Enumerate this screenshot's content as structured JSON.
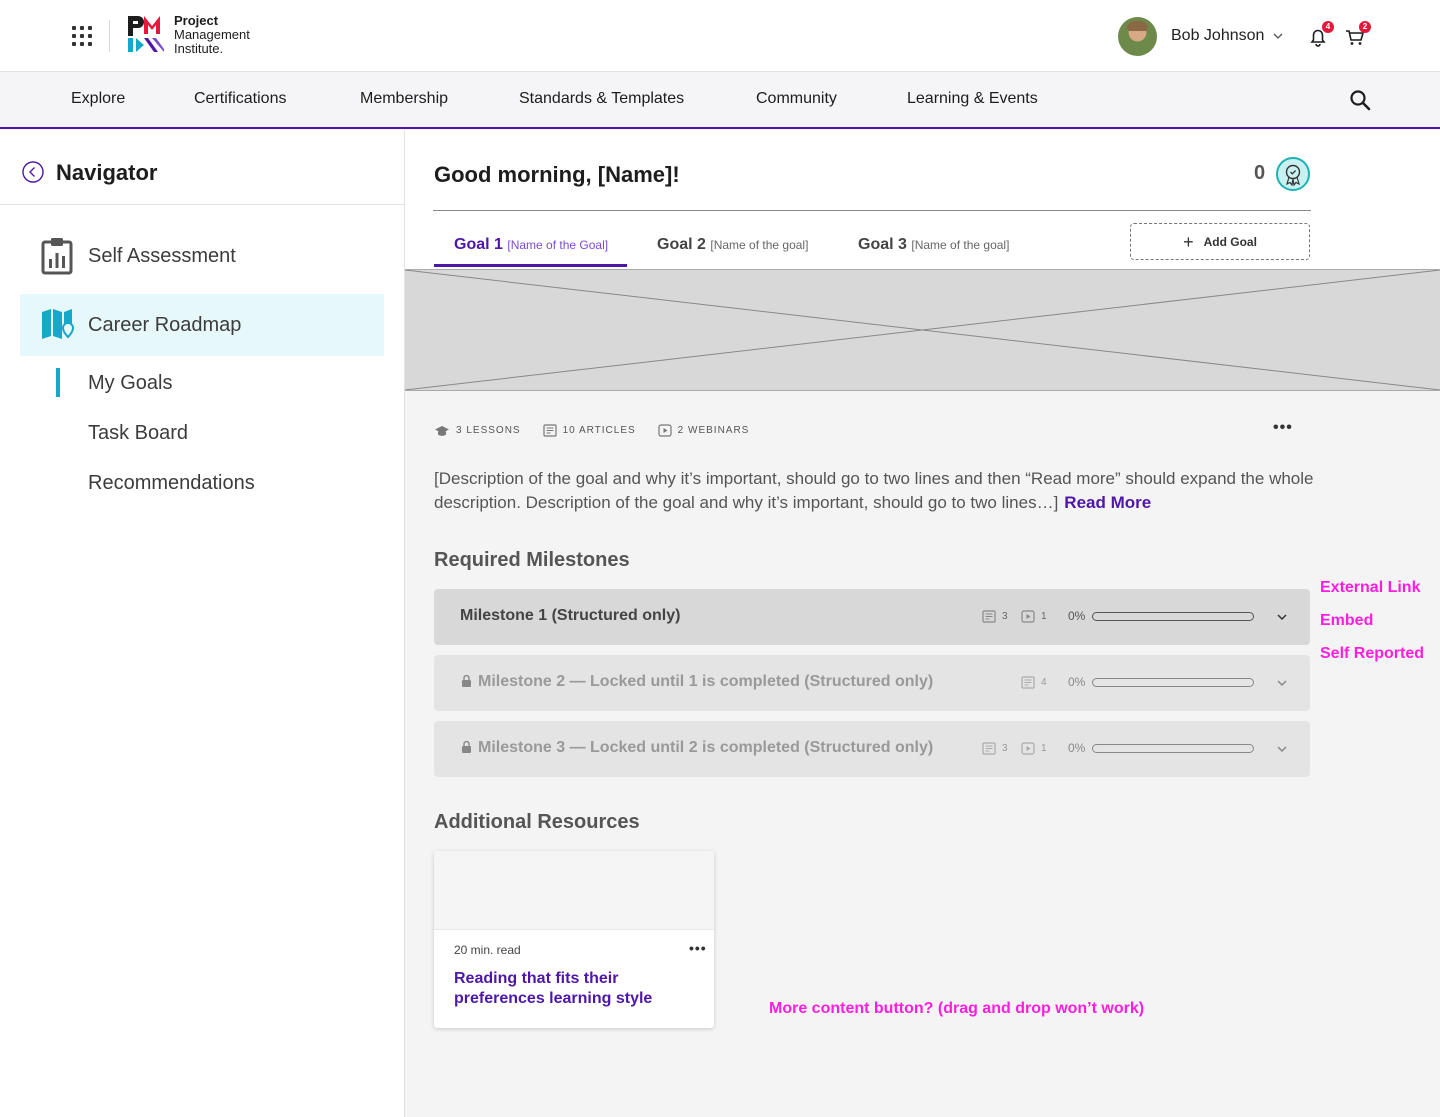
{
  "header": {
    "logo_line1": "Project",
    "logo_line2": "Management",
    "logo_line3": "Institute.",
    "user_name": "Bob Johnson",
    "notifications_count": "4",
    "cart_count": "2"
  },
  "nav": {
    "items": [
      "Explore",
      "Certifications",
      "Membership",
      "Standards & Templates",
      "Community",
      "Learning & Events"
    ]
  },
  "sidebar": {
    "title": "Navigator",
    "items": [
      {
        "label": "Self Assessment",
        "icon": "clipboard-chart-icon"
      },
      {
        "label": "Career Roadmap",
        "icon": "map-pin-icon"
      }
    ],
    "subitems": [
      "My Goals",
      "Task Board",
      "Recommendations"
    ]
  },
  "main": {
    "greeting": "Good morning, [Name]!",
    "points": "0",
    "tabs": [
      {
        "label": "Goal 1",
        "sub": "[Name of the Goal]"
      },
      {
        "label": "Goal 2",
        "sub": "[Name of the goal]"
      },
      {
        "label": "Goal 3",
        "sub": "[Name of the goal]"
      }
    ],
    "add_goal": "Add Goal",
    "meta": {
      "lessons": "3 LESSONS",
      "articles": "10 ARTICLES",
      "webinars": "2 WEBINARS"
    },
    "description": "[Description of the goal and why it’s important, should go to two lines and then “Read more” should expand the whole description. Description of the goal and why it’s important, should go to two lines…]",
    "read_more": "Read More",
    "required_heading": "Required Milestones",
    "milestones": [
      {
        "title": "Milestone 1 (Structured only)",
        "articles": "3",
        "webinars": "1",
        "pct_label": "0%",
        "progress": 0
      },
      {
        "title": "Milestone 2 — Locked until 1 is completed (Structured only)",
        "articles": "4",
        "pct_label": "0%",
        "progress": 0
      },
      {
        "title": "Milestone 3 — Locked until 2 is completed (Structured only)",
        "articles": "3",
        "webinars": "1",
        "pct_label": "0%",
        "progress": 0
      }
    ],
    "additional_heading": "Additional Resources",
    "card": {
      "read_time": "20 min. read",
      "title": "Reading that fits their preferences learning style"
    }
  },
  "annotations": {
    "external_link": "External Link",
    "embed": "Embed",
    "self_reported": "Self Reported",
    "more_content": "More content button? (drag and drop won’t work)"
  },
  "colors": {
    "brand_purple": "#4f17a8",
    "accent_teal": "#16a8c8",
    "annotation_magenta": "#ff1ee0",
    "badge_red": "#e6173b"
  }
}
